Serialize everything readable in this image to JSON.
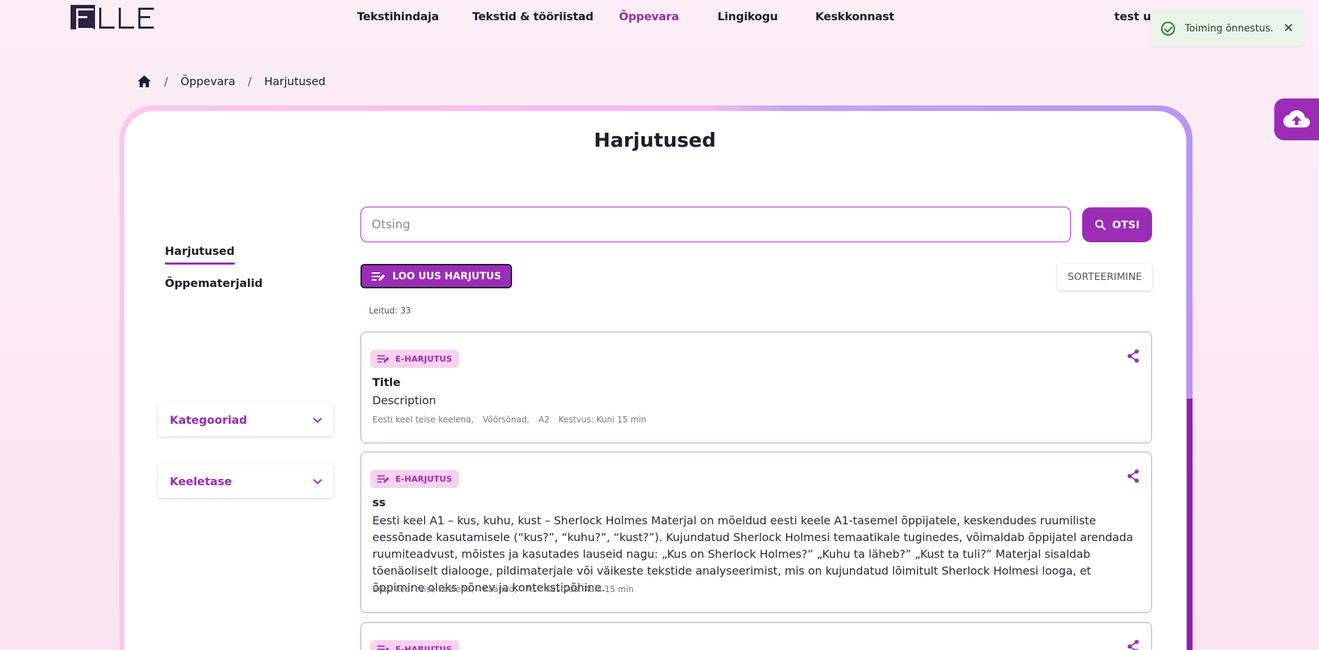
{
  "header": {
    "nav": [
      {
        "label": "Tekstihindaja",
        "active": false
      },
      {
        "label": "Tekstid & tööriistad",
        "active": false
      },
      {
        "label": "Õppevara",
        "active": true
      },
      {
        "label": "Lingikogu",
        "active": false
      },
      {
        "label": "Keskkonnast",
        "active": false
      }
    ],
    "user": "test us"
  },
  "toast": {
    "message": "Toiming õnnestus.",
    "close": "✕"
  },
  "breadcrumb": {
    "items": [
      "Õppevara",
      "Harjutused"
    ],
    "separator": "/"
  },
  "page": {
    "title": "Harjutused"
  },
  "sidebar": {
    "links": [
      {
        "label": "Harjutused",
        "active": true
      },
      {
        "label": "Õppematerjalid",
        "active": false
      }
    ],
    "filters": [
      {
        "label": "Kategooriad"
      },
      {
        "label": "Keeletase"
      }
    ]
  },
  "search": {
    "placeholder": "Otsing",
    "button": "OTSI"
  },
  "actions": {
    "new_exercise": "LOO UUS HARJUTUS",
    "sort": "SORTEERIMINE"
  },
  "results": {
    "found": "Leitud: 33"
  },
  "exercises": [
    {
      "badge": "E-HARJUTUS",
      "title": "Title",
      "description": "Description",
      "meta": [
        "Eesti keel teise keelena,",
        "Võõrsõnad,",
        "A2",
        "Kestvus: Kuni 15 min"
      ]
    },
    {
      "badge": "E-HARJUTUS",
      "title": "ss",
      "description": "Eesti keel A1 – kus, kuhu, kust – Sherlock Holmes Materjal on mõeldud eesti keele A1-tasemel õppijatele, keskendudes ruumiliste eessõnade kasutamisele (“kus?”, “kuhu?”, “kust?”). Kujundatud Sherlock Holmesi temaatikale tuginedes, võimaldab õppijatel arendada ruumiteadvust, mõistes ja kasutades lauseid nagu: „Kus on Sherlock Holmes?” „Kuhu ta läheb?” „Kust ta tuli?” Materjal sisaldab tõenäoliselt dialooge, pildimaterjale või väikeste tekstide analyseerimist, mis on kujundatud lõimitult Sherlock Holmesi looga, et õppimine oleks põnev ja kontekstipõhine.",
      "meta": [
        "Eesti keel teise keelena,",
        "Kääned,",
        "A1",
        "Kestvus: Kuni 15 min"
      ]
    },
    {
      "badge": "E-HARJUTUS"
    }
  ],
  "colors": {
    "accent": "#9b2cb5",
    "toast_bg": "#eaf5ea",
    "toast_icon": "#2e7d32"
  }
}
